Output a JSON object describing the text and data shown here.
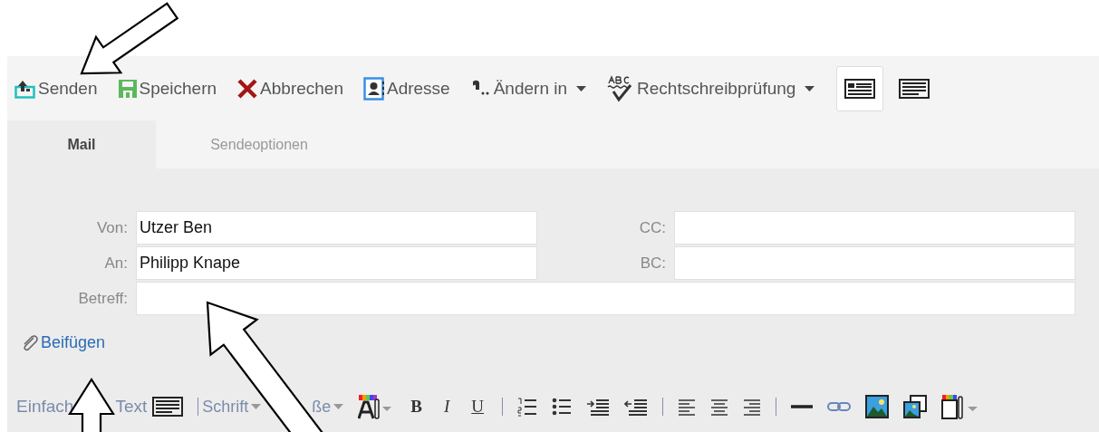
{
  "toolbar": {
    "buttons": [
      {
        "label": "Senden",
        "dropdown": false
      },
      {
        "label": "Speichern",
        "dropdown": false
      },
      {
        "label": "Abbrechen",
        "dropdown": false
      },
      {
        "label": "Adresse",
        "dropdown": false
      },
      {
        "label": "Ändern in",
        "dropdown": true
      },
      {
        "label": "Rechtschreibprüfung",
        "dropdown": true
      }
    ],
    "views": [
      {
        "selected": true
      },
      {
        "selected": false
      }
    ]
  },
  "tabs": [
    {
      "label": "Mail",
      "selected": true
    },
    {
      "label": "Sendeoptionen",
      "selected": false
    }
  ],
  "form": {
    "from": {
      "label": "Von:",
      "value": "Utzer Ben"
    },
    "to": {
      "label": "An:",
      "value": "Philipp Knape"
    },
    "cc": {
      "label": "CC:"
    },
    "bc": {
      "label": "BC:"
    },
    "subject": {
      "label": "Betreff:"
    },
    "attach": "Beifügen"
  },
  "format_toolbar": {
    "mode_start": "Einfach",
    "mode_end": "Text",
    "font": "Schrift",
    "size": "ße",
    "bold": "B",
    "italic": "I",
    "underline": "U"
  }
}
